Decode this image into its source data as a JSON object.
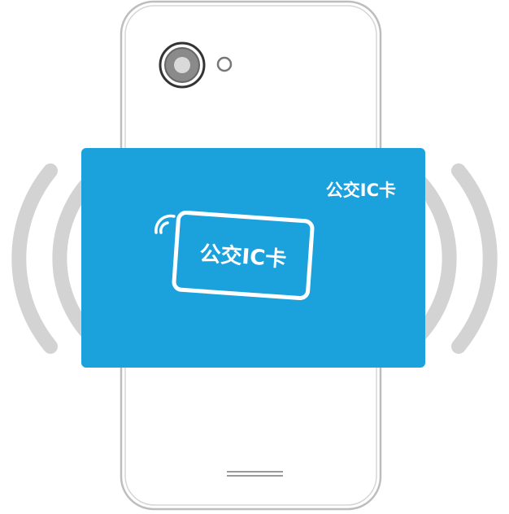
{
  "colors": {
    "card_blue": "#1ba2dd",
    "phone_outline": "#bdbdbd",
    "signal_arcs": "#d3d3d3",
    "white": "#ffffff"
  },
  "card": {
    "corner_label": "公交IC卡",
    "inner_card_label": "公交IC卡"
  },
  "icons": {
    "camera": "camera-lens-icon",
    "sensor": "sensor-dot-icon",
    "signal": "nfc-signal-icon",
    "home": "home-bar-icon"
  }
}
